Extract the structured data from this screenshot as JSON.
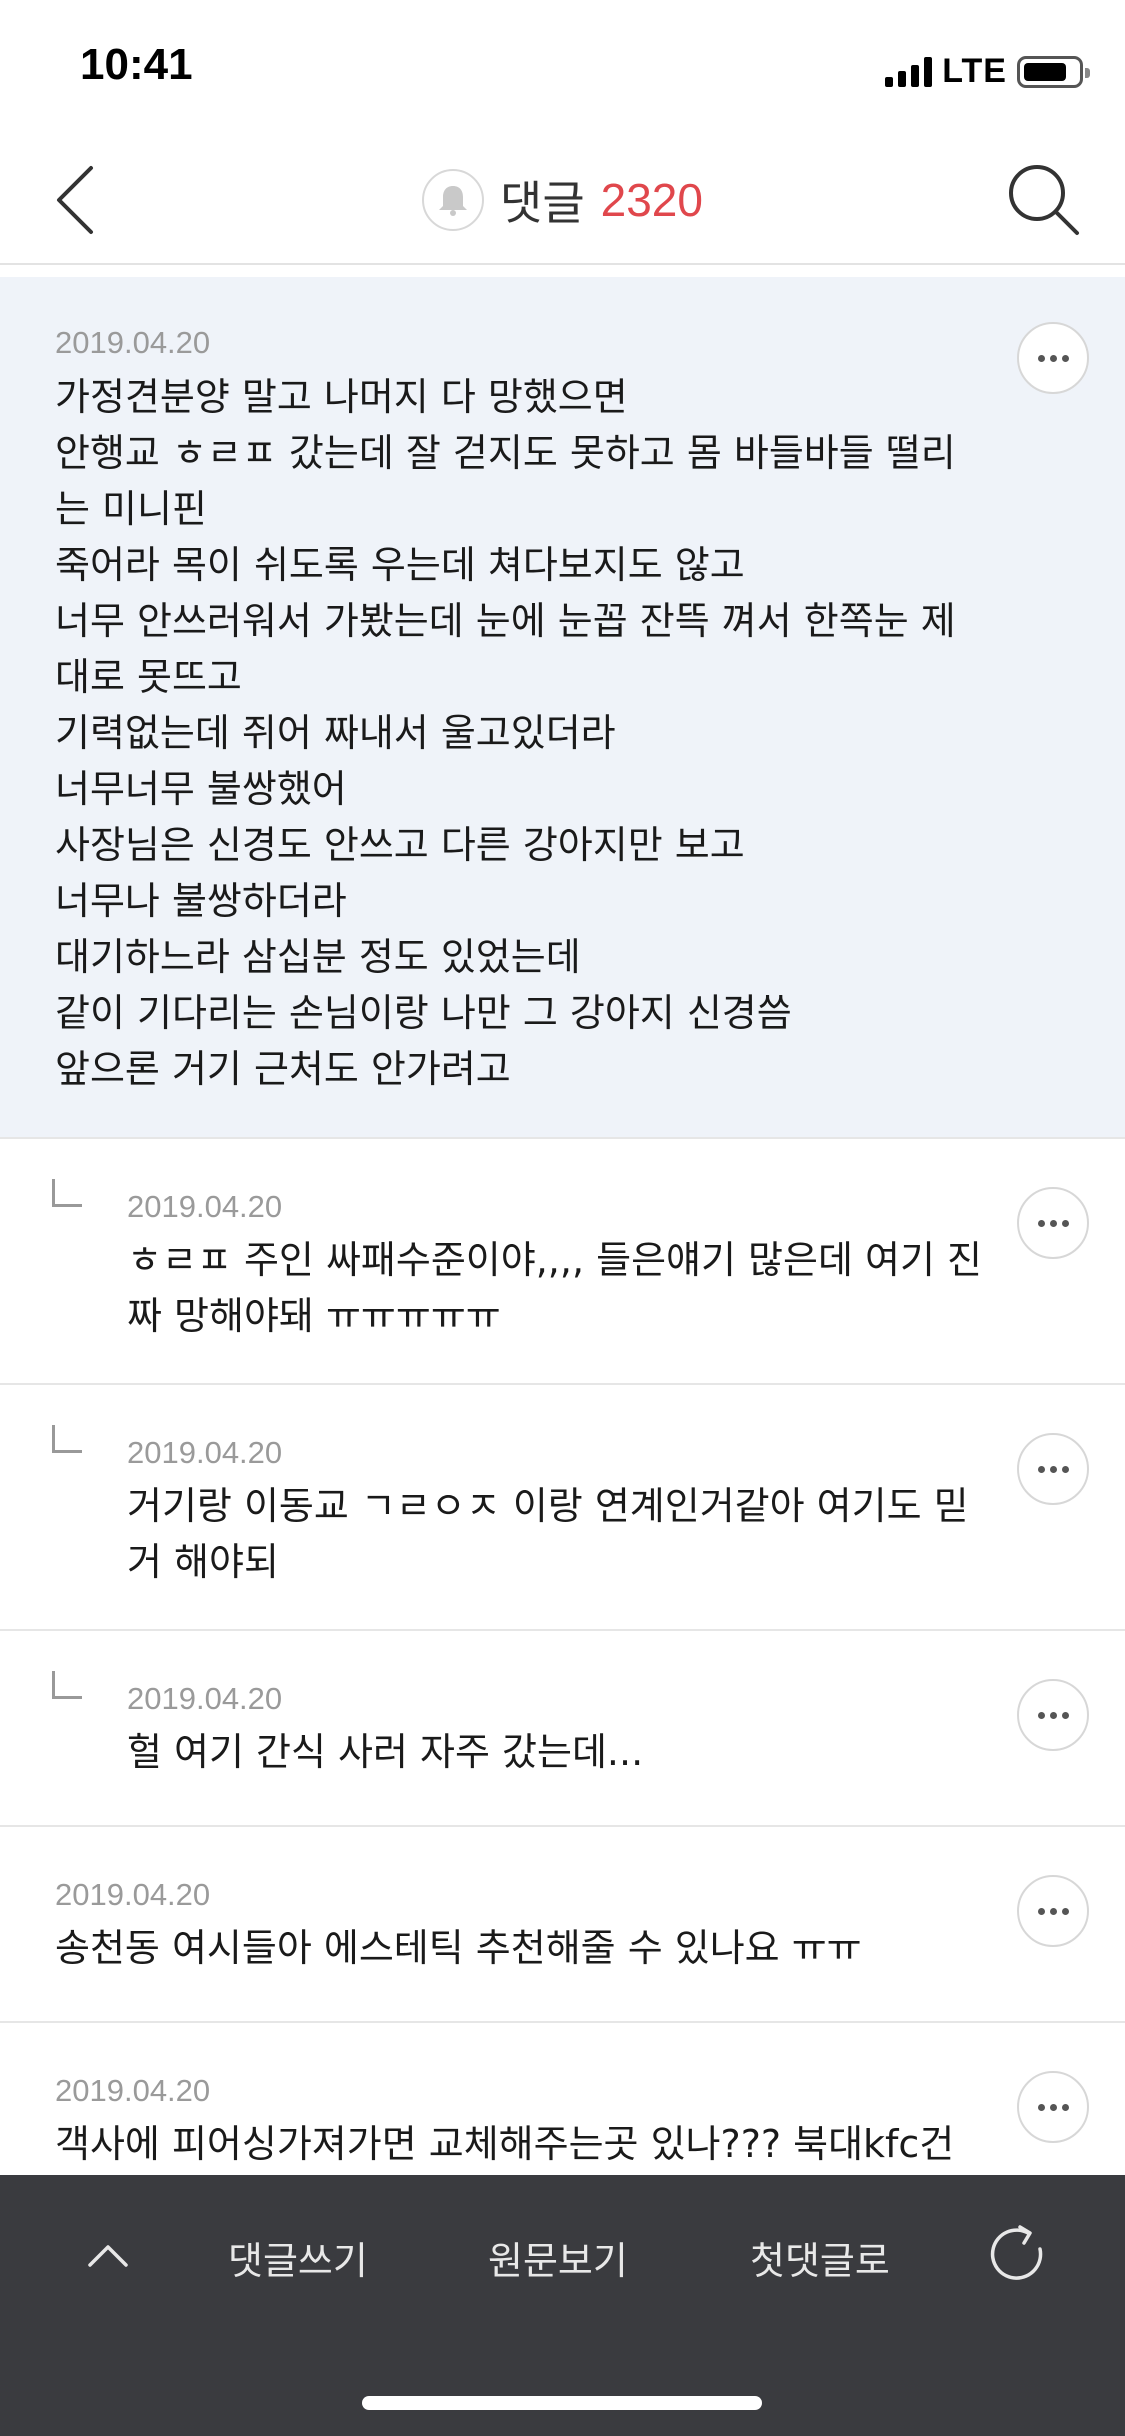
{
  "status": {
    "time": "10:41",
    "network": "LTE"
  },
  "header": {
    "title": "댓글",
    "count": "2320"
  },
  "comments": [
    {
      "date": "2019.04.20",
      "text": "가정견분양 말고 나머지 다 망했으면\n안행교 ㅎㄹㅍ 갔는데 잘 걷지도 못하고 몸 바들바들 떨리\n는 미니핀\n죽어라 목이 쉬도록 우는데 쳐다보지도 않고\n너무 안쓰러워서 가봤는데 눈에 눈꼽 잔뜩 껴서 한쪽눈 제\n대로 못뜨고\n기력없는데 쥐어 짜내서 울고있더라\n너무너무 불쌍했어\n사장님은 신경도 안쓰고 다른 강아지만 보고\n너무나 불쌍하더라\n대기하느라 삼십분 정도 있었는데\n같이 기다리는 손님이랑 나만 그 강아지 신경씀\n앞으론 거기 근처도 안가려고"
    },
    {
      "date": "2019.04.20",
      "text": "ㅎㄹㅍ 주인 싸패수준이야,,,, 들은얘기 많은데 여기 진\n짜 망해야돼 ㅠㅠㅠㅠㅠ"
    },
    {
      "date": "2019.04.20",
      "text": "거기랑 이동교 ㄱㄹㅇㅈ 이랑 연계인거같아 여기도 믿\n거 해야되"
    },
    {
      "date": "2019.04.20",
      "text": "헐 여기 간식 사러 자주 갔는데..."
    },
    {
      "date": "2019.04.20",
      "text": "송천동 여시들아 에스테틱 추천해줄 수 있나요 ㅠㅠ"
    },
    {
      "date": "2019.04.20",
      "text": "객사에 피어싱가져가면 교체해주는곳 있나??? 북대kfc건"
    }
  ],
  "bottom_bar": {
    "write_label": "댓글쓰기",
    "original_label": "원문보기",
    "first_label": "첫댓글로"
  },
  "colors": {
    "accent": "#e0474c",
    "highlight_bg": "#eff3f9",
    "bottom_bar_bg": "#3a3b3f"
  }
}
